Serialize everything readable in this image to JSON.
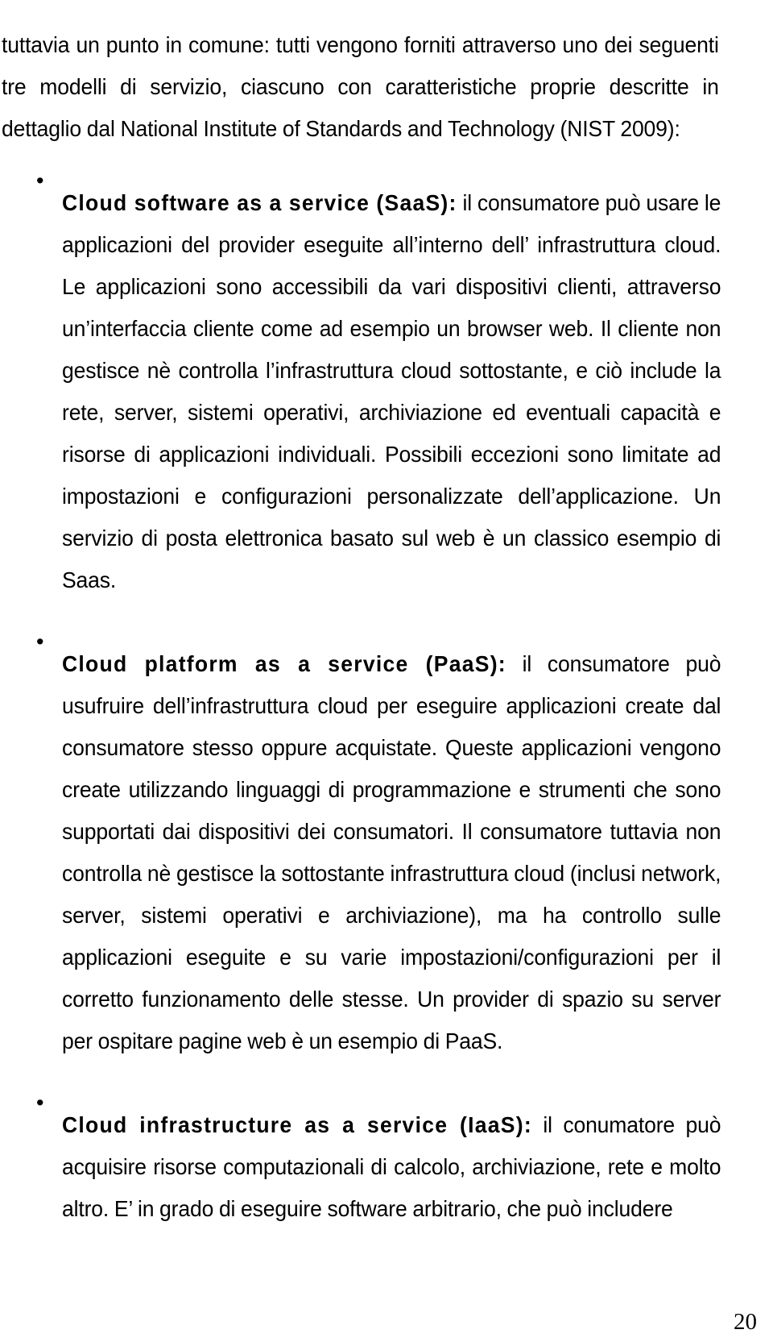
{
  "document": {
    "page_number": "20",
    "bullet_marker": "•",
    "intro_paragraph": "tuttavia un punto in comune: tutti vengono forniti attraverso uno dei seguenti tre modelli di servizio, ciascuno con caratteristiche proprie descritte in dettaglio dal National Institute of Standards and Technology (NIST 2009):",
    "bullets": [
      {
        "lead": "Cloud software as a service (SaaS):",
        "text": " il consumatore può usare le applicazioni del provider eseguite all’interno dell’ infrastruttura cloud. Le applicazioni sono accessibili da vari dispositivi clienti, attraverso un’interfaccia cliente come ad esempio un browser web. Il cliente non gestisce nè controlla l’infrastruttura cloud sottostante, e ciò include la rete, server, sistemi operativi, archiviazione ed eventuali capacità e risorse di applicazioni individuali. Possibili eccezioni sono limitate ad impostazioni e configurazioni personalizzate dell’applicazione. Un servizio di posta elettronica basato sul web è un classico esempio di Saas."
      },
      {
        "lead": "Cloud platform as a service (PaaS):",
        "text": " il consumatore può usufruire dell’infrastruttura cloud per eseguire applicazioni create dal consumatore stesso oppure acquistate. Queste applicazioni vengono create utilizzando linguaggi di programmazione e strumenti che sono supportati dai dispositivi dei consumatori. Il consumatore tuttavia non controlla nè gestisce la sottostante infrastruttura cloud (inclusi network, server, sistemi operativi e archiviazione), ma ha controllo sulle applicazioni eseguite e su varie impostazioni/configurazioni per il corretto funzionamento delle stesse. Un provider di spazio su server per ospitare pagine web è un esempio di PaaS."
      },
      {
        "lead": "Cloud infrastructure as a service (IaaS):",
        "text": " il conumatore può acquisire risorse computazionali di calcolo, archiviazione, rete e molto altro. E’ in grado di eseguire software arbitrario, che può includere"
      }
    ]
  }
}
